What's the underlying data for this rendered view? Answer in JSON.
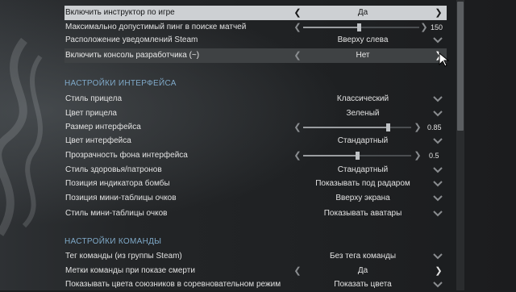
{
  "rows_top": [
    {
      "label": "Включить инструктор по игре",
      "value": "Да",
      "type": "toggle",
      "state": "selected"
    },
    {
      "label": "Максимально допустимый пинг в поиске матчей",
      "value": "150",
      "type": "slider",
      "level": 0.48
    },
    {
      "label": "Расположение уведомлений Steam",
      "value": "Вверху слева",
      "type": "dropdown"
    },
    {
      "label": "Включить консоль разработчика (~)",
      "value": "Нет",
      "type": "toggle",
      "state": "hover"
    }
  ],
  "section_interface": {
    "title": "НАСТРОЙКИ ИНТЕРФЕЙСА",
    "rows": [
      {
        "label": "Стиль прицела",
        "value": "Классический",
        "type": "dropdown"
      },
      {
        "label": "Цвет прицела",
        "value": "Зеленый",
        "type": "dropdown"
      },
      {
        "label": "Размер интерфейса",
        "value": "0.85",
        "type": "slider",
        "level": 0.78
      },
      {
        "label": "Цвет интерфейса",
        "value": "Стандартный",
        "type": "dropdown"
      },
      {
        "label": "Прозрачность фона интерфейса",
        "value": "0.5",
        "type": "slider",
        "level": 0.5
      },
      {
        "label": "Стиль здоровья/патронов",
        "value": "Стандартный",
        "type": "dropdown"
      },
      {
        "label": "Позиция индикатора бомбы",
        "value": "Показывать под радаром",
        "type": "dropdown"
      },
      {
        "label": "Позиция мини-таблицы очков",
        "value": "Вверху экрана",
        "type": "dropdown"
      },
      {
        "label": "Стиль мини-таблицы очков",
        "value": "Показывать аватары",
        "type": "dropdown"
      }
    ]
  },
  "section_team": {
    "title": "НАСТРОЙКИ КОМАНДЫ",
    "rows": [
      {
        "label": "Тег команды (из группы Steam)",
        "value": "Без тега команды",
        "type": "dropdown"
      },
      {
        "label": "Метки команды при показе смерти",
        "value": "Да",
        "type": "toggle"
      },
      {
        "label": "Показывать цвета союзников в соревновательном режим",
        "value": "Показать цвета",
        "type": "dropdown"
      }
    ]
  },
  "icons": {
    "arrow_left": "chevron-left-icon",
    "arrow_right": "chevron-right-icon",
    "dropdown": "chevron-down-icon",
    "glyph_left": "❮",
    "glyph_right": "❯"
  },
  "colors": {
    "section_title": "#7fa9c8",
    "highlight_row": "#cdd0d3",
    "background": "#1c1e20"
  }
}
